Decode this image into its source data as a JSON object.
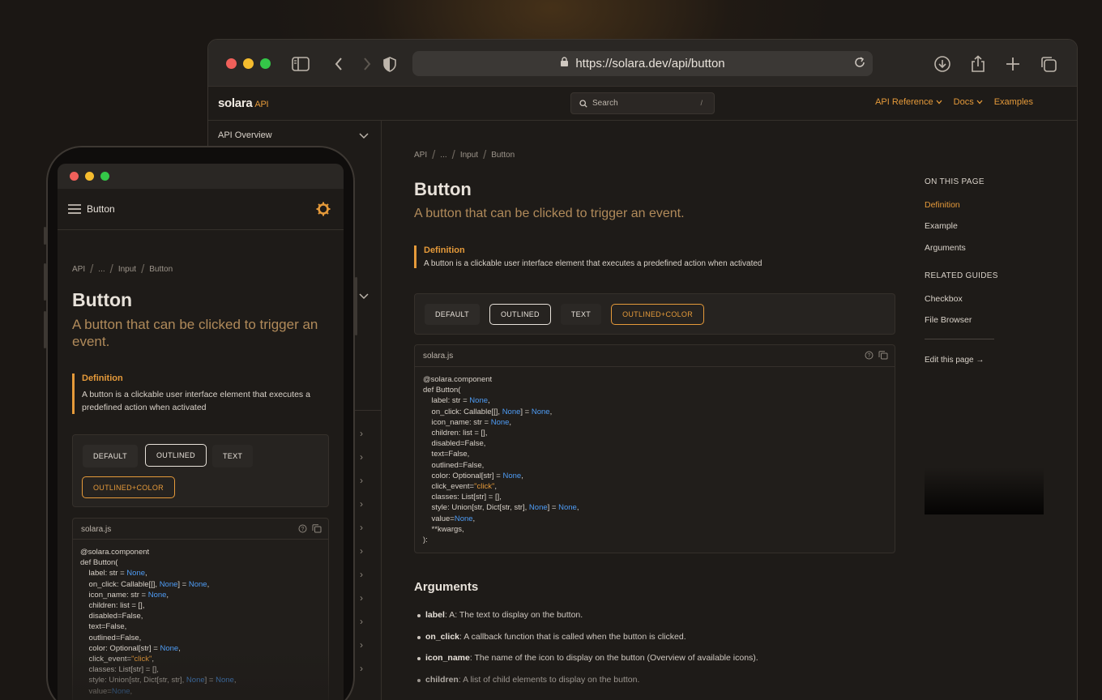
{
  "browser": {
    "url": "https://solara.dev/api/button",
    "traffic": [
      "#f0605a",
      "#f5bc2e",
      "#34c748"
    ]
  },
  "site": {
    "logo": "solara",
    "logo_suffix": "API",
    "search_placeholder": "Search",
    "search_shortcut": "/",
    "nav": [
      "API Reference",
      "Docs",
      "Examples"
    ]
  },
  "sidebar": {
    "section": "API Overview"
  },
  "page": {
    "breadcrumb": [
      "API",
      "...",
      "Input",
      "Button"
    ],
    "title": "Button",
    "subtitle": "A button that can be clicked to trigger an event.",
    "definition_title": "Definition",
    "definition_text": "A button is a clickable user interface element that executes a predefined action when activated",
    "demo_buttons": [
      "DEFAULT",
      "OUTLINED",
      "TEXT",
      "OUTLINED+COLOR"
    ],
    "code_filename": "solara.js",
    "arguments_title": "Arguments",
    "arguments": [
      {
        "name": "label",
        "desc": ": A: The text to display on the button."
      },
      {
        "name": "on_click",
        "desc": ": A callback function that is called when the button is clicked."
      },
      {
        "name": "icon_name",
        "desc": ": The name of the icon to display on the button (Overview of available icons)."
      },
      {
        "name": "children",
        "desc": ": A list of child elements to display on the button."
      }
    ]
  },
  "toc": {
    "heading": "ON THIS PAGE",
    "items": [
      "Definition",
      "Example",
      "Arguments"
    ],
    "related_heading": "RELATED GUIDES",
    "related": [
      "Checkbox",
      "File Browser"
    ],
    "edit": "Edit this page →"
  },
  "phone": {
    "header_title": "Button"
  },
  "colors": {
    "accent": "#e59a3a",
    "keyword": "#4e9cf5",
    "background": "#1b1714"
  }
}
